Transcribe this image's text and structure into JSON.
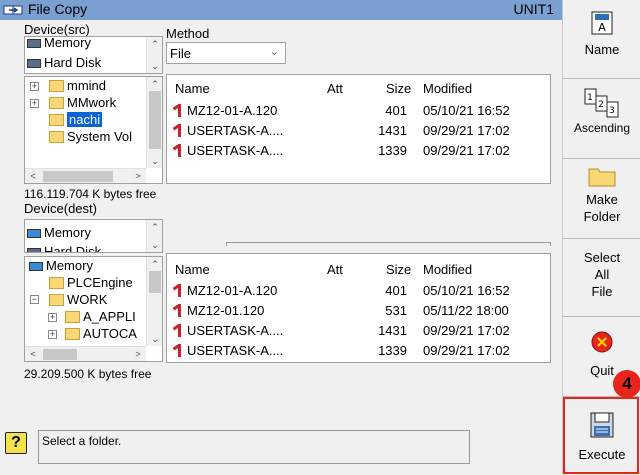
{
  "window": {
    "title": "File Copy",
    "unit": "UNIT1"
  },
  "src": {
    "device_label": "Device(src)",
    "method_label": "Method",
    "method_value": "File",
    "drives": [
      "Memory",
      "Hard Disk"
    ],
    "tree": [
      "mmind",
      "MMwork",
      "nachi",
      "System Vol"
    ],
    "free_space": "116.119.704 K bytes free",
    "columns": {
      "name": "Name",
      "att": "Att",
      "size": "Size",
      "modified": "Modified"
    },
    "files": [
      {
        "name": "MZ12-01-A.120",
        "size": "401",
        "modified": "05/10/21 16:52"
      },
      {
        "name": "USERTASK-A....",
        "size": "1431",
        "modified": "09/29/21 17:02"
      },
      {
        "name": "USERTASK-A....",
        "size": "1339",
        "modified": "09/29/21 17:02"
      }
    ]
  },
  "dest": {
    "device_label": "Device(dest)",
    "drives": [
      "Memory",
      "Hard Disk"
    ],
    "tree": [
      "Memory",
      "PLCEngine",
      "WORK",
      "A_APPLI",
      "AUTOCA"
    ],
    "free_space": "29.209.500 K bytes free",
    "columns": {
      "name": "Name",
      "att": "Att",
      "size": "Size",
      "modified": "Modified"
    },
    "files": [
      {
        "name": "MZ12-01-A.120",
        "size": "401",
        "modified": "05/10/21 16:52"
      },
      {
        "name": "MZ12-01.120",
        "size": "531",
        "modified": "05/11/22 18:00"
      },
      {
        "name": "USERTASK-A....",
        "size": "1431",
        "modified": "09/29/21 17:02"
      },
      {
        "name": "USERTASK-A....",
        "size": "1339",
        "modified": "09/29/21 17:02"
      }
    ]
  },
  "toolbar": {
    "name_label": "Name",
    "sort_label": "Ascending",
    "make_folder_line1": "Make",
    "make_folder_line2": "Folder",
    "select_all_line1": "Select",
    "select_all_line2": "All",
    "select_all_line3": "File",
    "quit_label": "Quit",
    "execute_label": "Execute"
  },
  "status": {
    "message": "Select a folder."
  },
  "annotation": {
    "step": "4",
    "color": "#e8251b"
  },
  "colors": {
    "title_bar": "#7a9fd1",
    "selection": "#0a64d6",
    "file_icon": "#d0202a"
  }
}
